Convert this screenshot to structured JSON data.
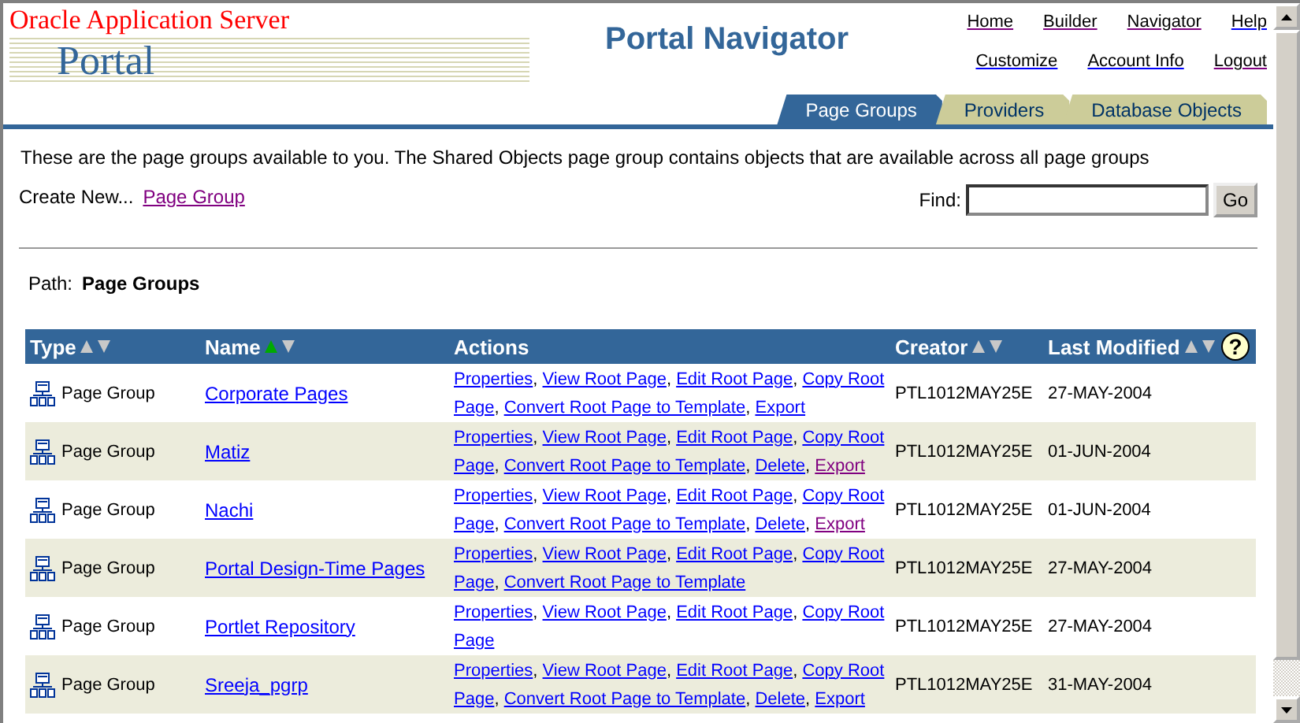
{
  "logo": {
    "vendor": "Oracle Application Server",
    "product": "Portal"
  },
  "title": "Portal Navigator",
  "nav_links": [
    [
      {
        "label": "Home",
        "visited": true
      },
      {
        "label": "Builder",
        "visited": true
      },
      {
        "label": "Navigator",
        "visited": true
      },
      {
        "label": "Help",
        "visited": false
      }
    ],
    [
      {
        "label": "Customize",
        "visited": false
      },
      {
        "label": "Account Info",
        "visited": false
      },
      {
        "label": "Logout",
        "visited": true
      }
    ]
  ],
  "tabs": [
    {
      "label": "Page Groups",
      "selected": true
    },
    {
      "label": "Providers",
      "selected": false
    },
    {
      "label": "Database Objects",
      "selected": false
    }
  ],
  "description": "These are the page groups available to you. The Shared Objects page group contains objects that are available across all page groups",
  "create_new": {
    "label": "Create New...",
    "link": "Page Group",
    "link_visited": true
  },
  "find": {
    "label": "Find:",
    "button": "Go"
  },
  "path": {
    "label": "Path:",
    "value": "Page Groups"
  },
  "table": {
    "help": "?",
    "separator": ",",
    "columns": [
      {
        "label": "Type",
        "sortable": true,
        "sorted_ascending": false
      },
      {
        "label": "Name",
        "sortable": true,
        "sorted_ascending": true
      },
      {
        "label": "Actions",
        "sortable": false
      },
      {
        "label": "Creator",
        "sortable": true,
        "sorted_ascending": false
      },
      {
        "label": "Last Modified",
        "sortable": true,
        "sorted_ascending": false
      }
    ],
    "rows": [
      {
        "type": "Page Group",
        "name": "Corporate Pages",
        "action_lines": [
          [
            {
              "label": "Properties",
              "visited": false
            },
            {
              "label": "View Root Page",
              "visited": false
            },
            {
              "label": "Edit Root Page",
              "visited": false
            },
            {
              "label": "Copy Root",
              "visited": false
            }
          ],
          [
            {
              "label": "Page",
              "visited": false
            },
            {
              "label": "Convert Root Page to Template",
              "visited": false
            },
            {
              "label": "Export",
              "visited": false
            }
          ]
        ],
        "creator": "PTL1012MAY25E",
        "last_modified": "27-MAY-2004"
      },
      {
        "type": "Page Group",
        "name": "Matiz",
        "action_lines": [
          [
            {
              "label": "Properties",
              "visited": false
            },
            {
              "label": "View Root Page",
              "visited": false
            },
            {
              "label": "Edit Root Page",
              "visited": false
            },
            {
              "label": "Copy Root",
              "visited": false
            }
          ],
          [
            {
              "label": "Page",
              "visited": false
            },
            {
              "label": "Convert Root Page to Template",
              "visited": false
            },
            {
              "label": "Delete",
              "visited": false
            },
            {
              "label": "Export",
              "visited": true
            }
          ]
        ],
        "creator": "PTL1012MAY25E",
        "last_modified": "01-JUN-2004"
      },
      {
        "type": "Page Group",
        "name": "Nachi",
        "action_lines": [
          [
            {
              "label": "Properties",
              "visited": false
            },
            {
              "label": "View Root Page",
              "visited": false
            },
            {
              "label": "Edit Root Page",
              "visited": false
            },
            {
              "label": "Copy Root",
              "visited": false
            }
          ],
          [
            {
              "label": "Page",
              "visited": false
            },
            {
              "label": "Convert Root Page to Template",
              "visited": false
            },
            {
              "label": "Delete",
              "visited": false
            },
            {
              "label": "Export",
              "visited": true
            }
          ]
        ],
        "creator": "PTL1012MAY25E",
        "last_modified": "01-JUN-2004"
      },
      {
        "type": "Page Group",
        "name": "Portal Design-Time Pages",
        "action_lines": [
          [
            {
              "label": "Properties",
              "visited": false
            },
            {
              "label": "View Root Page",
              "visited": false
            },
            {
              "label": "Edit Root Page",
              "visited": false
            },
            {
              "label": "Copy Root",
              "visited": false
            }
          ],
          [
            {
              "label": "Page",
              "visited": false
            },
            {
              "label": "Convert Root Page to Template",
              "visited": false
            }
          ]
        ],
        "creator": "PTL1012MAY25E",
        "last_modified": "27-MAY-2004"
      },
      {
        "type": "Page Group",
        "name": "Portlet Repository",
        "action_lines": [
          [
            {
              "label": "Properties",
              "visited": false
            },
            {
              "label": "View Root Page",
              "visited": false
            },
            {
              "label": "Edit Root Page",
              "visited": false
            },
            {
              "label": "Copy Root",
              "visited": false
            }
          ],
          [
            {
              "label": "Page",
              "visited": false
            }
          ]
        ],
        "creator": "PTL1012MAY25E",
        "last_modified": "27-MAY-2004"
      },
      {
        "type": "Page Group",
        "name": "Sreeja_pgrp",
        "action_lines": [
          [
            {
              "label": "Properties",
              "visited": false
            },
            {
              "label": "View Root Page",
              "visited": false
            },
            {
              "label": "Edit Root Page",
              "visited": false
            },
            {
              "label": "Copy Root",
              "visited": false
            }
          ],
          [
            {
              "label": "Page",
              "visited": false
            },
            {
              "label": "Convert Root Page to Template",
              "visited": false
            },
            {
              "label": "Delete",
              "visited": false
            },
            {
              "label": "Export",
              "visited": false
            }
          ]
        ],
        "creator": "PTL1012MAY25E",
        "last_modified": "31-MAY-2004"
      }
    ]
  }
}
